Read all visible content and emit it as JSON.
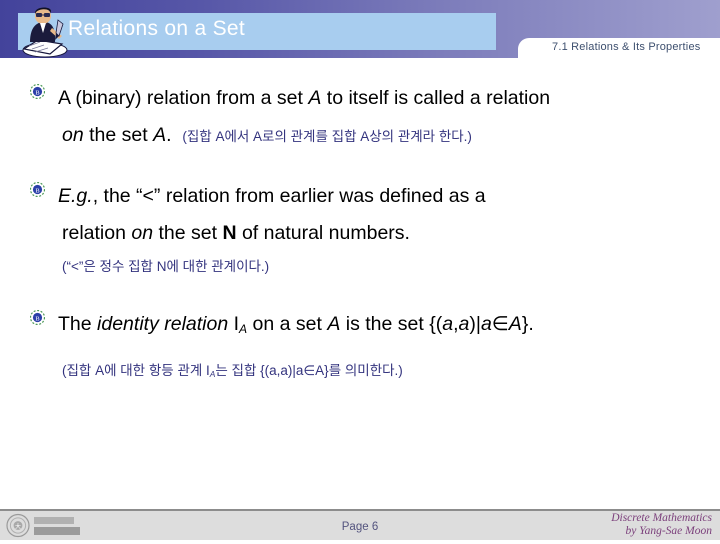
{
  "header": {
    "title": "Relations on a Set",
    "section_tab": "7.1 Relations & Its Properties",
    "writer_icon": "person-writing-icon",
    "band_gradient_from": "#43439b",
    "band_gradient_to": "#9f9fce",
    "title_plate_color": "#a8cdef",
    "tab_text_color": "#3d4f6e"
  },
  "bullets": [
    {
      "icon": "decorative-bullet-icon",
      "line1_a": "A (binary) relation from a set ",
      "line1_i": "A",
      "line1_b": " to itself is called a relation",
      "line2_i": "on",
      "line2_b": " the set ",
      "line2_i2": "A",
      "line2_c": ".",
      "line2_kr": "(집합 A에서 A로의 관계를 집합 A상의 관계라 한다.)"
    },
    {
      "icon": "decorative-bullet-icon",
      "line1_i": "E.g.",
      "line1_b": ", the “<” relation from earlier was defined as a",
      "line2_a": "relation ",
      "line2_i": "on",
      "line2_b": " the set ",
      "line2_bold": "N",
      "line2_c": " of natural numbers.",
      "line3_kr": "(“<”은 정수 집합 N에 대한 관계이다.)"
    },
    {
      "icon": "decorative-bullet-icon",
      "line1_a": "The ",
      "line1_i": "identity relation",
      "line1_b": " I",
      "line1_sub": "A",
      "line1_c": " on a set ",
      "line1_i2": "A",
      "line1_d": " is the set {(",
      "line1_i3": "a",
      "line1_e": ",",
      "line1_i4": "a",
      "line1_f": ")|",
      "line1_i5": "a",
      "line1_g": "∈",
      "line1_i6": "A",
      "line1_h": "}.",
      "line2_kr": "(집합 A에 대한 항등 관계 I",
      "line2_kr_sub": "A",
      "line2_kr_b": "는 집합 {(a,a)|a∈A}를 의미한다.)"
    }
  ],
  "footer": {
    "logo": "university-logo",
    "page_label": "Page 6",
    "course_title": "Discrete Mathematics",
    "author": "by Yang-Sae Moon",
    "band_color": "#dddddd",
    "page_color": "#53537e",
    "right_color": "#7b3f7b"
  }
}
